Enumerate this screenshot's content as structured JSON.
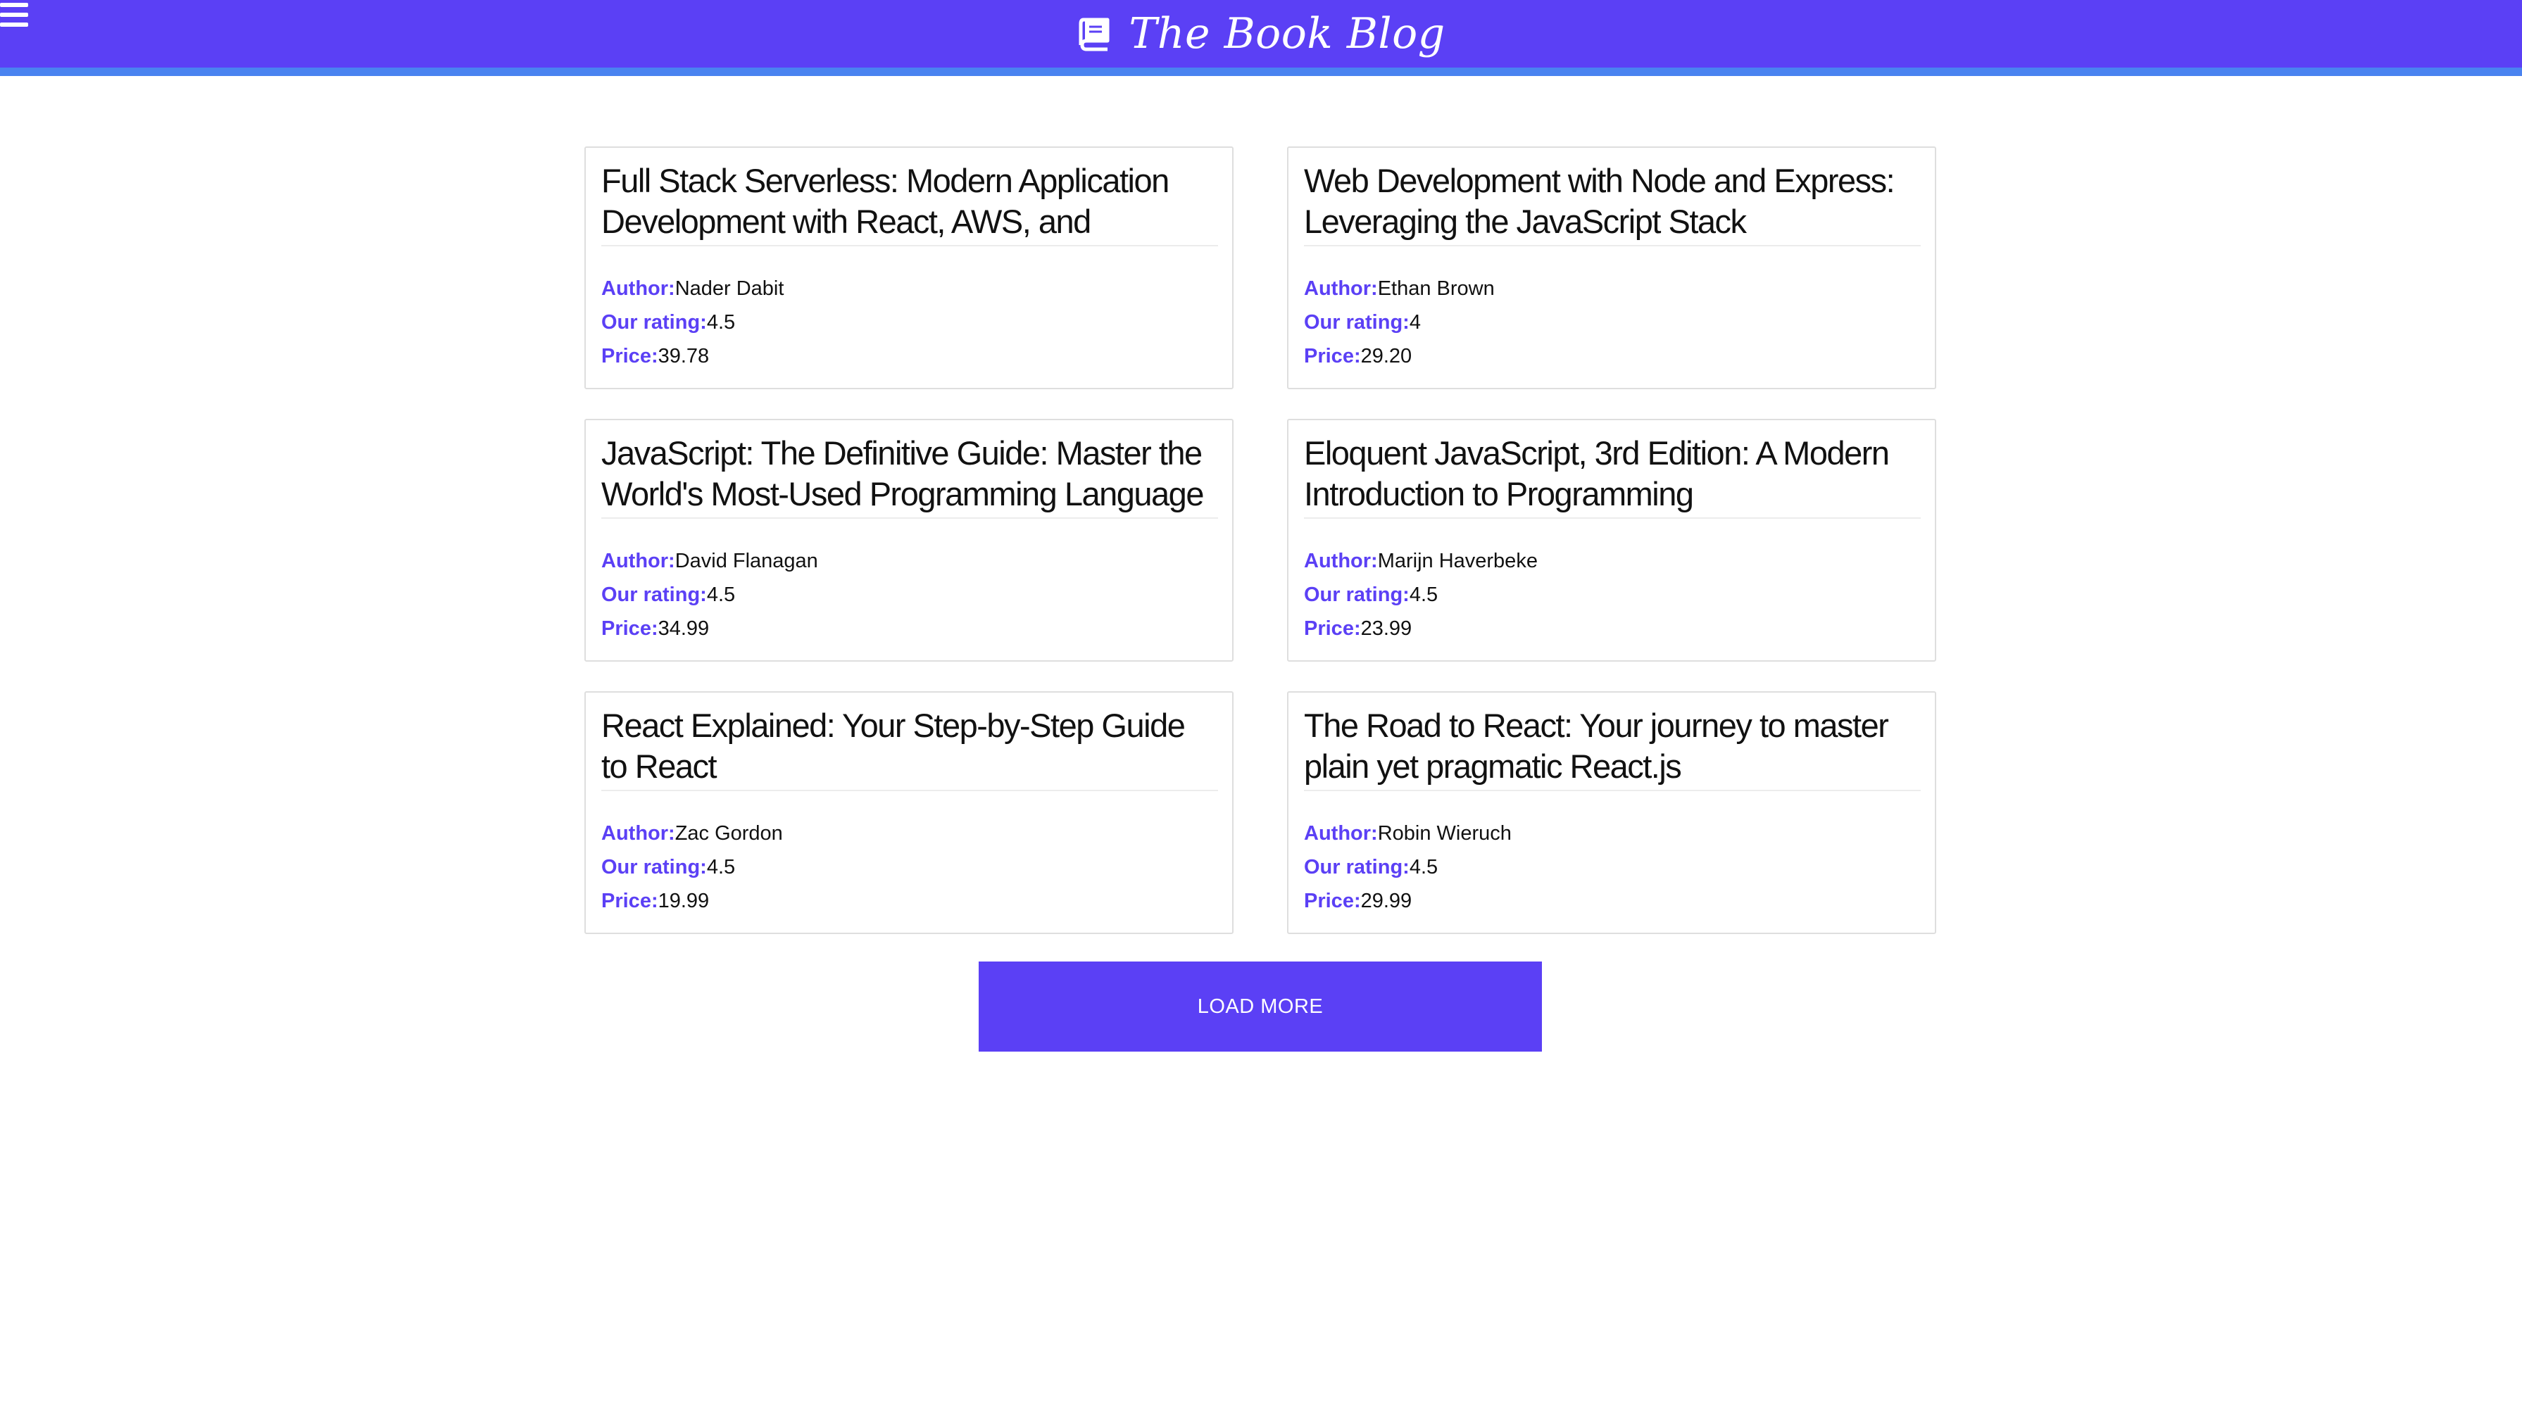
{
  "header": {
    "title": "The Book Blog",
    "menu_icon": "hamburger-menu-icon",
    "brand_icon": "book-icon",
    "bg_color": "#5b40f5",
    "underline_color": "#4a83f0"
  },
  "labels": {
    "author": "Author:",
    "rating": "Our rating:",
    "price": "Price:"
  },
  "books": [
    {
      "title": "Full Stack Serverless: Modern Application Development with React, AWS, and GraphQL",
      "author": "Nader Dabit",
      "rating": "4.5",
      "price": "39.78"
    },
    {
      "title": "Web Development with Node and Express: Leveraging the JavaScript Stack",
      "author": "Ethan Brown",
      "rating": "4",
      "price": "29.20"
    },
    {
      "title": "JavaScript: The Definitive Guide: Master the World's Most-Used Programming Language",
      "author": "David Flanagan",
      "rating": "4.5",
      "price": "34.99"
    },
    {
      "title": "Eloquent JavaScript, 3rd Edition: A Modern Introduction to Programming",
      "author": "Marijn Haverbeke",
      "rating": "4.5",
      "price": "23.99"
    },
    {
      "title": "React Explained: Your Step-by-Step Guide to React",
      "author": "Zac Gordon",
      "rating": "4.5",
      "price": "19.99"
    },
    {
      "title": "The Road to React: Your journey to master plain yet pragmatic React.js",
      "author": "Robin Wieruch",
      "rating": "4.5",
      "price": "29.99"
    }
  ],
  "load_more": {
    "label": "LOAD MORE"
  }
}
